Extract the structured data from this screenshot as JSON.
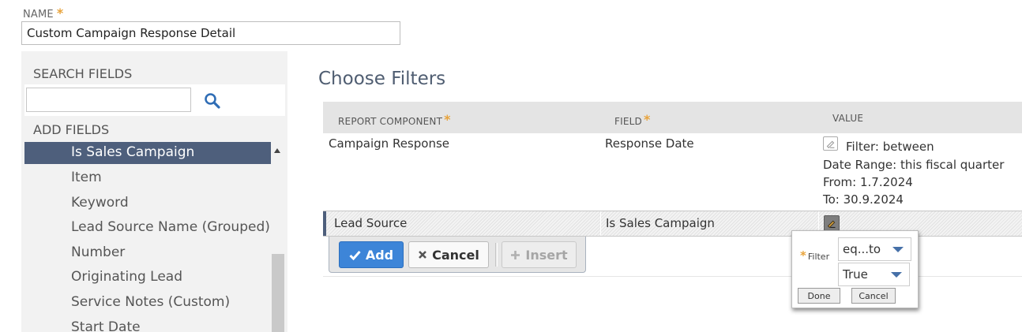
{
  "name_field": {
    "label": "NAME",
    "value": "Custom Campaign Response Detail"
  },
  "left_panel": {
    "search_fields_label": "SEARCH FIELDS",
    "search_placeholder": "",
    "add_fields_label": "ADD FIELDS",
    "fields": [
      {
        "label": "Is Sales Campaign",
        "selected": true
      },
      {
        "label": "Item"
      },
      {
        "label": "Keyword"
      },
      {
        "label": "Lead Source Name (Grouped)"
      },
      {
        "label": "Number"
      },
      {
        "label": "Originating Lead"
      },
      {
        "label": "Service Notes (Custom)"
      },
      {
        "label": "Start Date"
      }
    ]
  },
  "main": {
    "title": "Choose Filters",
    "columns": [
      "REPORT COMPONENT",
      "FIELD",
      "VALUE"
    ],
    "rows": [
      {
        "component": "Campaign Response",
        "field": "Response Date",
        "value_lines": [
          "Filter: between",
          "Date Range: this fiscal quarter",
          "From: 1.7.2024",
          "To: 30.9.2024"
        ]
      },
      {
        "component": "Lead Source",
        "field": "Is Sales Campaign"
      }
    ],
    "toolbar": {
      "add_label": "Add",
      "cancel_label": "Cancel",
      "insert_label": "Insert"
    }
  },
  "filter_popup": {
    "filter_label": "Filter",
    "operator_value": "eq...to",
    "value": "True",
    "done_label": "Done",
    "cancel_label": "Cancel"
  },
  "colors": {
    "accent_blue": "#3d85d8",
    "selected_row": "#4e5f7c",
    "required_star": "#e8a33b",
    "title": "#4f5d71"
  },
  "icons": [
    "search-icon",
    "scroll-up-icon",
    "edit-icon",
    "checkmark-icon",
    "x-icon",
    "plus-icon",
    "chevron-down-icon"
  ]
}
